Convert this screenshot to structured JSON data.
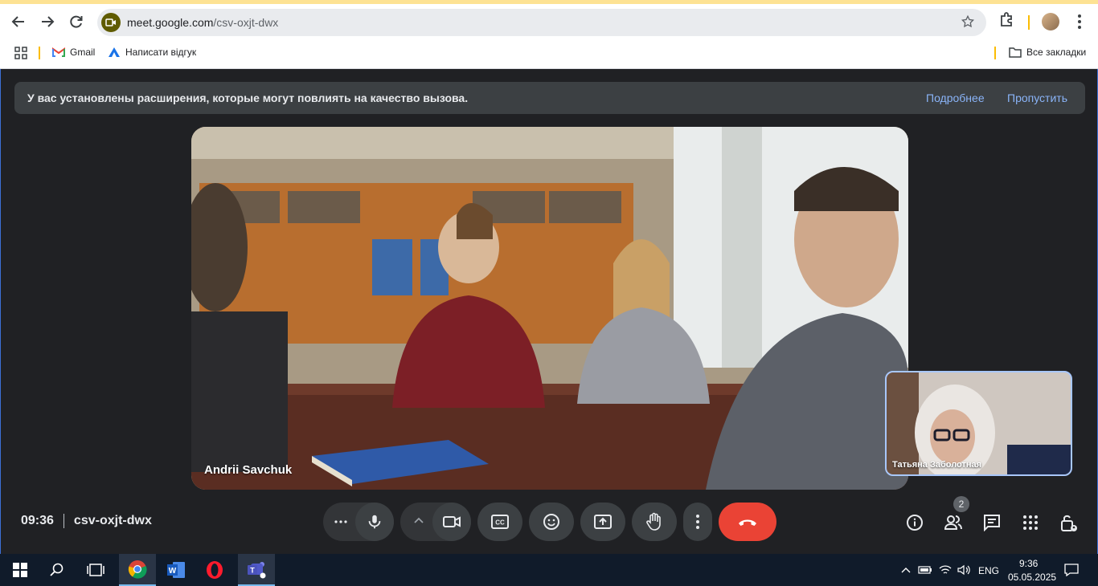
{
  "browser": {
    "url_host": "meet.google.com",
    "url_path": "/csv-oxjt-dwx",
    "bookmarks": [
      {
        "label": "Gmail",
        "icon": "gmail-icon"
      },
      {
        "label": "Написати відгук",
        "icon": "feedback-icon"
      }
    ],
    "all_bookmarks_label": "Все закладки"
  },
  "banner": {
    "text": "У вас установлены расширения, которые могут повлиять на качество вызова.",
    "learn_more": "Подробнее",
    "dismiss": "Пропустить"
  },
  "main_tile": {
    "participant_name": "Andrii Savchuk"
  },
  "self_tile": {
    "participant_name": "Татьяна Заболотная"
  },
  "meeting": {
    "time": "09:36",
    "code": "csv-oxjt-dwx"
  },
  "controls": {
    "people_count": "2",
    "hangup_color": "#ea4335"
  },
  "taskbar": {
    "language": "ENG",
    "clock_time": "9:36",
    "clock_date": "05.05.2025"
  },
  "colors": {
    "meet_background": "#202124",
    "link": "#8ab4f8",
    "accent_border": "#a8c7fa"
  }
}
